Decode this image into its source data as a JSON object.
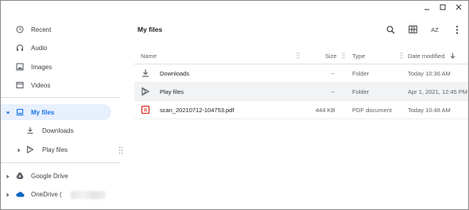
{
  "sidebar": {
    "items": [
      {
        "label": "Recent",
        "icon": "clock-icon"
      },
      {
        "label": "Audio",
        "icon": "headphones-icon"
      },
      {
        "label": "Images",
        "icon": "image-icon"
      },
      {
        "label": "Videos",
        "icon": "video-icon"
      },
      {
        "label": "My files",
        "icon": "computer-icon"
      },
      {
        "label": "Downloads",
        "icon": "download-icon"
      },
      {
        "label": "Play files",
        "icon": "play-store-icon"
      },
      {
        "label": "Google Drive",
        "icon": "google-drive-icon"
      },
      {
        "label": "OneDrive (",
        "icon": "onedrive-cloud-icon"
      }
    ]
  },
  "main": {
    "title": "My files",
    "sort_label": "AZ",
    "columns": {
      "name": "Name",
      "size": "Size",
      "type": "Type",
      "date": "Date modified"
    },
    "rows": [
      {
        "name": "Downloads",
        "size": "--",
        "type": "Folder",
        "date": "Today 10:36 AM",
        "icon": "download-icon"
      },
      {
        "name": "Play files",
        "size": "--",
        "type": "Folder",
        "date": "Apr 1, 2021, 12:45 PM",
        "icon": "play-store-icon"
      },
      {
        "name": "scan_20210712-104753.pdf",
        "size": "444 KB",
        "type": "PDF document",
        "date": "Today 10:48 AM",
        "icon": "pdf-icon"
      }
    ]
  },
  "colors": {
    "accent": "#1a73e8",
    "selected_bg": "#e8f0fe",
    "row_hover": "#f1f3f4",
    "pdf": "#d93025"
  }
}
